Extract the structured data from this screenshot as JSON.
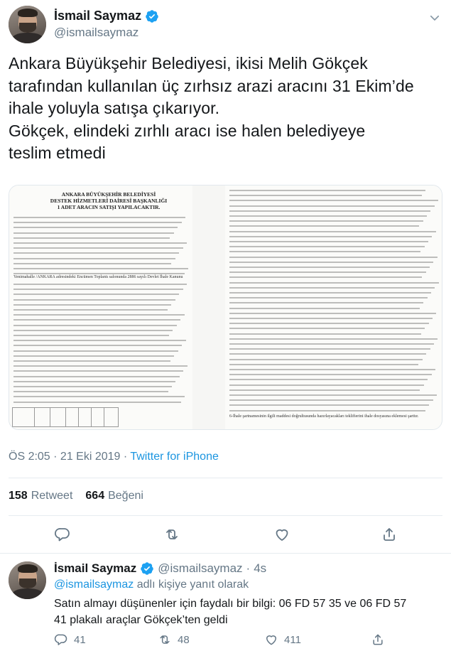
{
  "tweet": {
    "author_name": "İsmail Saymaz",
    "author_handle": "@ismailsaymaz",
    "text_lines": [
      "Ankara Büyükşehir Belediyesi, ikisi Melih Gökçek",
      "tarafından kullanılan üç zırhsız arazi aracını 31 Ekim’de",
      "ihale yoluyla satışa çıkarıyor.",
      "Gökçek, elindeki zırhlı aracı ise halen belediyeye",
      "teslim etmedi"
    ],
    "timestamp": "ÖS 2:05 · 21 Eki 2019 · ",
    "source": "Twitter for iPhone",
    "retweets_count": "158",
    "retweets_label": "Retweet",
    "likes_count": "664",
    "likes_label": "Beğeni"
  },
  "media": {
    "doc_title_lines": [
      "ANKARA BÜYÜKŞEHİR BELEDİYESİ",
      "DESTEK HİZMETLERİ DAİRESİ BAŞKANLIĞI",
      "1 ADET ARACIN SATIŞI YAPILACAKTIR."
    ],
    "left_caption": "Yenimahalle /ANKARA adresindeki Encümen Toplantı salonunda 2886 sayılı Devlet İhale Kanunu",
    "right_caption": "6-İhale şartnamesinin ilgili maddesi doğrultusunda hazırlayacakları teklifierini ihale dosyasına eklemesi şarttır."
  },
  "reply": {
    "author_name": "İsmail Saymaz",
    "author_handle": "@ismailsaymaz",
    "dot": "·",
    "time": "4s",
    "replying_mention": "@ismailsaymaz",
    "replying_suffix": " adlı kişiye yanıt olarak",
    "text_lines": [
      "Satın almayı düşünenler için faydalı bir bilgi: 06 FD 57 35 ve 06 FD 57",
      "41 plakalı araçlar Gökçek’ten geldi"
    ],
    "reply_count": "41",
    "retweet_count": "48",
    "like_count": "411"
  },
  "colors": {
    "verified": "#1da1f2",
    "link": "#1b95e0",
    "muted": "#657786"
  },
  "icons": [
    "verified-badge-icon",
    "chevron-down-icon",
    "reply-icon",
    "retweet-icon",
    "like-icon",
    "share-icon"
  ]
}
